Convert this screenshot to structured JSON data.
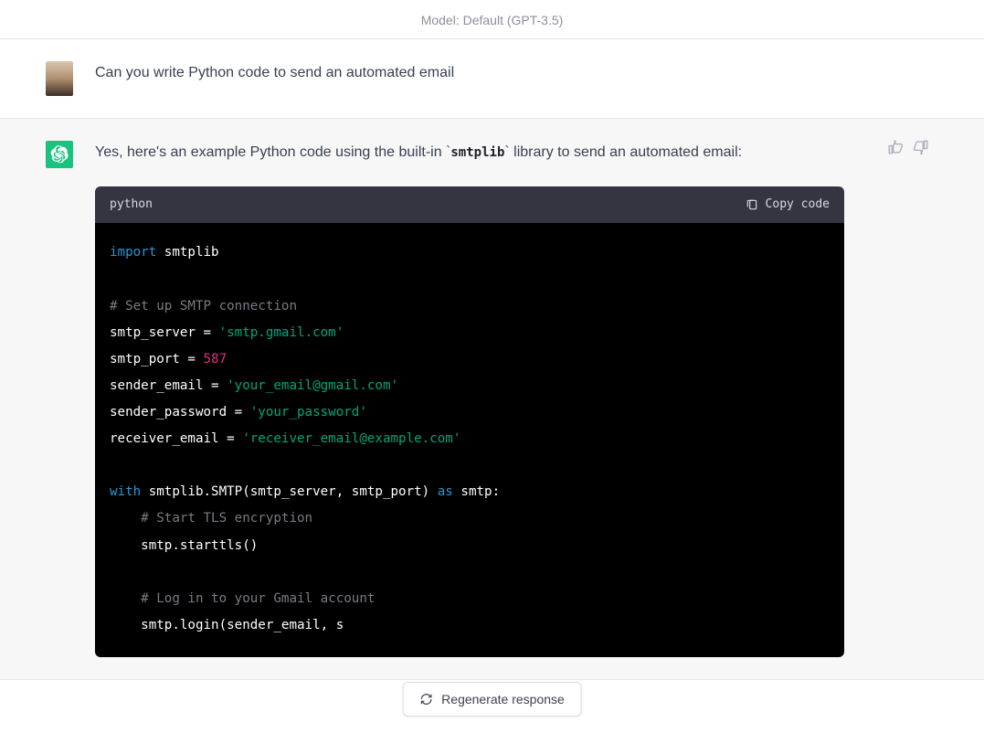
{
  "header": {
    "model_label": "Model: Default (GPT-3.5)"
  },
  "user_message": {
    "text": "Can you write Python code to send an automated email"
  },
  "assistant_message": {
    "intro_pre": "Yes, here's an example Python code using the built-in ",
    "inline_code": "smtplib",
    "intro_post": " library to send an automated email:"
  },
  "code_block": {
    "language": "python",
    "copy_label": "Copy code",
    "tokens": {
      "import_kw": "import",
      "smtplib_mod": " smtplib",
      "comment1": "# Set up SMTP connection",
      "var1": "smtp_server = ",
      "str1": "'smtp.gmail.com'",
      "var2": "smtp_port = ",
      "num2": "587",
      "var3": "sender_email = ",
      "str3": "'your_email@gmail.com'",
      "var4": "sender_password = ",
      "str4": "'your_password'",
      "var5": "receiver_email = ",
      "str5": "'receiver_email@example.com'",
      "with_kw": "with",
      "with_body": " smtplib.SMTP(smtp_server, smtp_port) ",
      "as_kw": "as",
      "as_body": " smtp:",
      "comment2": "# Start TLS encryption",
      "line_starttls": "smtp.starttls()",
      "comment3": "# Log in to your Gmail account",
      "line_login": "smtp.login(sender_email, s"
    }
  },
  "actions": {
    "regenerate_label": "Regenerate response"
  }
}
